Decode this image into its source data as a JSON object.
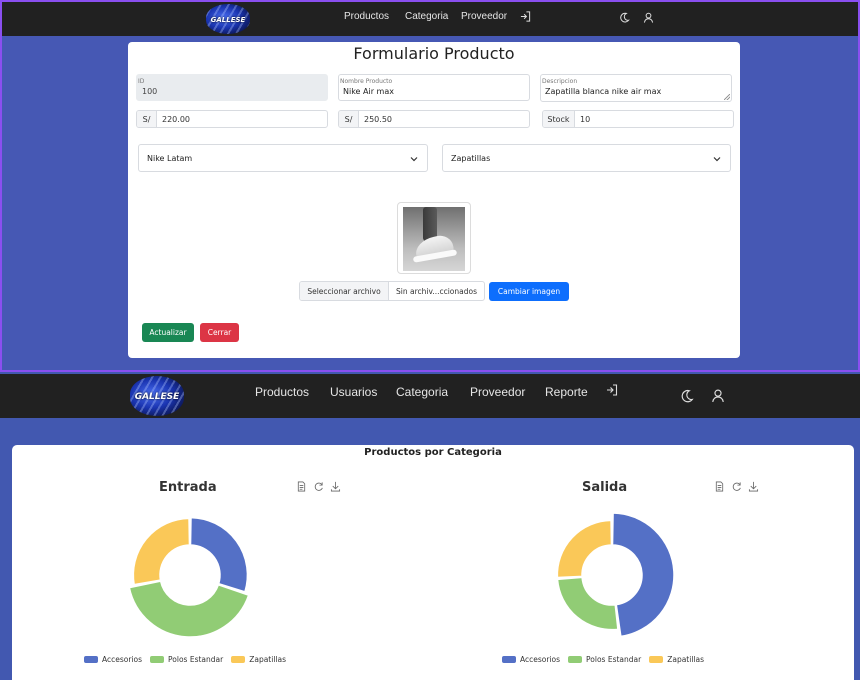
{
  "top_window": {
    "nav": {
      "logo_text": "GALLESE",
      "links": [
        "Productos",
        "Categoria",
        "Proveedor"
      ]
    },
    "form": {
      "title": "Formulario Producto",
      "id": {
        "label": "ID",
        "value": "100"
      },
      "nombre": {
        "label": "Nombre Producto",
        "value": "Nike Air max"
      },
      "descripcion": {
        "label": "Descripcion",
        "value": "Zapatilla blanca nike air max"
      },
      "precio_compra": {
        "prefix": "S/",
        "value": "220.00"
      },
      "precio_venta": {
        "prefix": "S/",
        "value": "250.50"
      },
      "stock": {
        "prefix": "Stock",
        "value": "10"
      },
      "proveedor_select": "Nike Latam",
      "categoria_select": "Zapatillas",
      "file_button": "Seleccionar archivo",
      "file_text": "Sin archiv...ccionados",
      "change_image_button": "Cambiar imagen",
      "update_button": "Actualizar",
      "close_button": "Cerrar"
    }
  },
  "bottom_window": {
    "nav": {
      "logo_text": "GALLESE",
      "links": [
        "Productos",
        "Usuarios",
        "Categoria",
        "Proveedor",
        "Reporte"
      ]
    },
    "card_title": "Productos por Categoria",
    "colors": {
      "Accesorios": "#5470c6",
      "Polos Estandar": "#91cc75",
      "Zapatillas": "#fac858"
    },
    "legend": [
      "Accesorios",
      "Polos Estandar",
      "Zapatillas"
    ]
  },
  "chart_data": [
    {
      "type": "pie",
      "title": "Entrada",
      "categories": [
        "Accesorios",
        "Polos Estandar",
        "Zapatillas"
      ],
      "values": [
        30,
        42,
        28
      ],
      "colors": [
        "#5470c6",
        "#91cc75",
        "#fac858"
      ],
      "style": "rose-donut",
      "legend_position": "bottom"
    },
    {
      "type": "pie",
      "title": "Salida",
      "categories": [
        "Accesorios",
        "Polos Estandar",
        "Zapatillas"
      ],
      "values": [
        48,
        26,
        26
      ],
      "colors": [
        "#5470c6",
        "#91cc75",
        "#fac858"
      ],
      "style": "rose-donut",
      "legend_position": "bottom"
    }
  ]
}
